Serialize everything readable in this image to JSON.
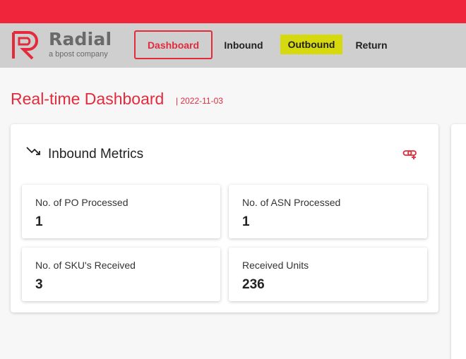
{
  "brand": {
    "name": "Radial",
    "tagline": "a bpost company",
    "accent_color": "#e32b3c",
    "logo_mark_icon": "r-logo-icon"
  },
  "nav": {
    "items": [
      {
        "label": "Dashboard",
        "active": true
      },
      {
        "label": "Inbound",
        "active": false
      },
      {
        "label": "Outbound",
        "active": false,
        "highlighted": true,
        "highlight_color": "#d6d90d"
      },
      {
        "label": "Return",
        "active": false
      }
    ]
  },
  "page": {
    "title": "Real-time Dashboard",
    "date": "| 2022-11-03"
  },
  "inbound_card": {
    "title": "Inbound Metrics",
    "title_icon": "trending-down-icon",
    "action_icon": "link-icon",
    "metrics": [
      {
        "label": "No. of PO Processed",
        "value": "1"
      },
      {
        "label": "No. of ASN Processed",
        "value": "1"
      },
      {
        "label": "No. of SKU's Received",
        "value": "3"
      },
      {
        "label": "Received Units",
        "value": "236"
      }
    ]
  }
}
